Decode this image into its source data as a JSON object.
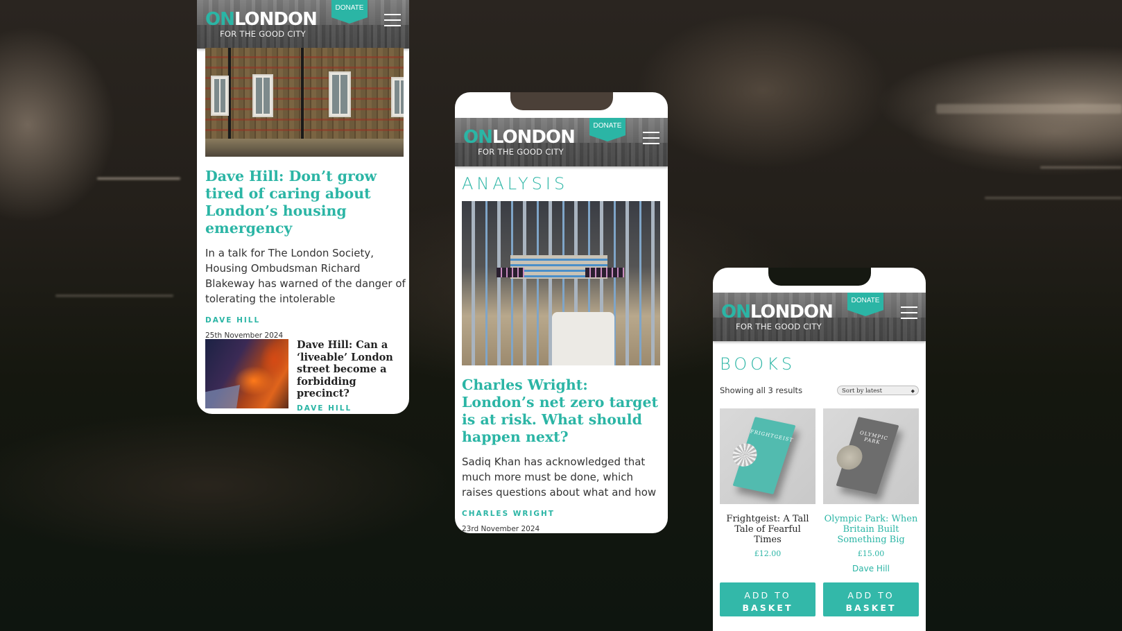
{
  "brand": {
    "logo_on": "ON",
    "logo_london": "LONDON",
    "tagline": "FOR THE GOOD CITY",
    "donate_label": "DONATE",
    "menu_icon": "hamburger-menu-icon",
    "accent_color": "#2bb5a5"
  },
  "phone1": {
    "lead_article": {
      "headline": "Dave Hill: Don’t grow tired of caring about London’s housing emergency",
      "standfirst": "In a talk for The London Society, Housing Ombudsman Richard Blakeway has warned of the danger of tolerating the intolerable",
      "byline": "DAVE HILL",
      "date": "25th November 2024"
    },
    "secondary_article": {
      "headline": "Dave Hill: Can a ‘liveable’ London street become a forbidding precinct?",
      "byline": "DAVE HILL"
    }
  },
  "phone2": {
    "section_title": "ANALYSIS",
    "article": {
      "headline": "Charles Wright: London’s net zero target is at risk. What should happen next?",
      "standfirst": "Sadiq Khan has acknowledged that much more must be done, which raises questions about what and how",
      "byline": "CHARLES WRIGHT",
      "date": "23rd November 2024"
    }
  },
  "phone3": {
    "section_title": "BOOKS",
    "results_text": "Showing all 3 results",
    "sort_selected": "Sort by latest",
    "products": [
      {
        "cover_title": "FRIGHTGEIST",
        "name": "Frightgeist: A Tall Tale of Fearful Times",
        "price": "£12.00",
        "author": "",
        "button_line1": "ADD TO",
        "button_line2": "BASKET"
      },
      {
        "cover_title": "OLYMPIC PARK",
        "name": "Olympic Park: When Britain Built Something Big",
        "price": "£15.00",
        "author": "Dave Hill",
        "button_line1": "ADD TO",
        "button_line2": "BASKET"
      }
    ]
  }
}
